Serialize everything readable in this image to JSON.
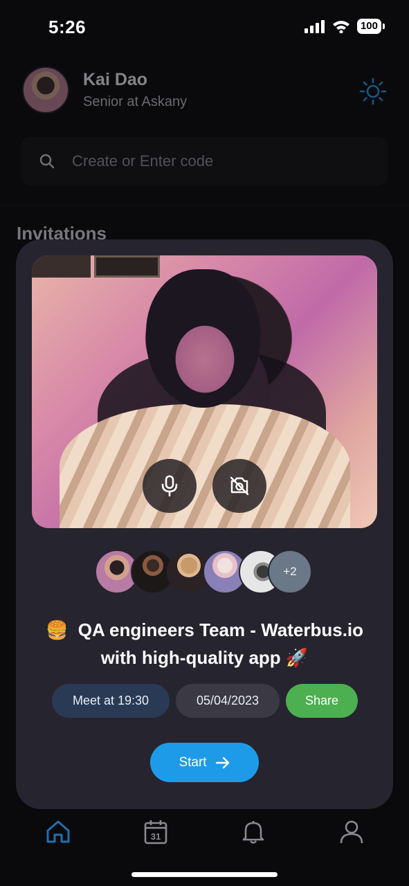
{
  "status_bar": {
    "time": "5:26",
    "battery": "100"
  },
  "profile": {
    "name": "Kai Dao",
    "role": "Senior at Askany"
  },
  "search": {
    "placeholder": "Create or Enter code"
  },
  "section": {
    "title": "Invitations"
  },
  "meeting": {
    "title_emoji": "🍔",
    "title_line1": "QA engineers Team - Waterbus.io",
    "title_line2": "with high-quality app",
    "title_end_emoji": "🚀",
    "participants_more": "+2",
    "time_label": "Meet at 19:30",
    "date_label": "05/04/2023",
    "share_label": "Share",
    "start_label": "Start"
  },
  "nav": {
    "items": [
      "home-icon",
      "calendar-icon",
      "bell-icon",
      "user-icon"
    ],
    "calendar_day": "31",
    "active": "home"
  },
  "colors": {
    "accent": "#1e9be8",
    "share": "#4caf50",
    "card_bg": "#26242f",
    "time_chip": "#2a3a55",
    "nav_active": "#1e6fb0"
  }
}
